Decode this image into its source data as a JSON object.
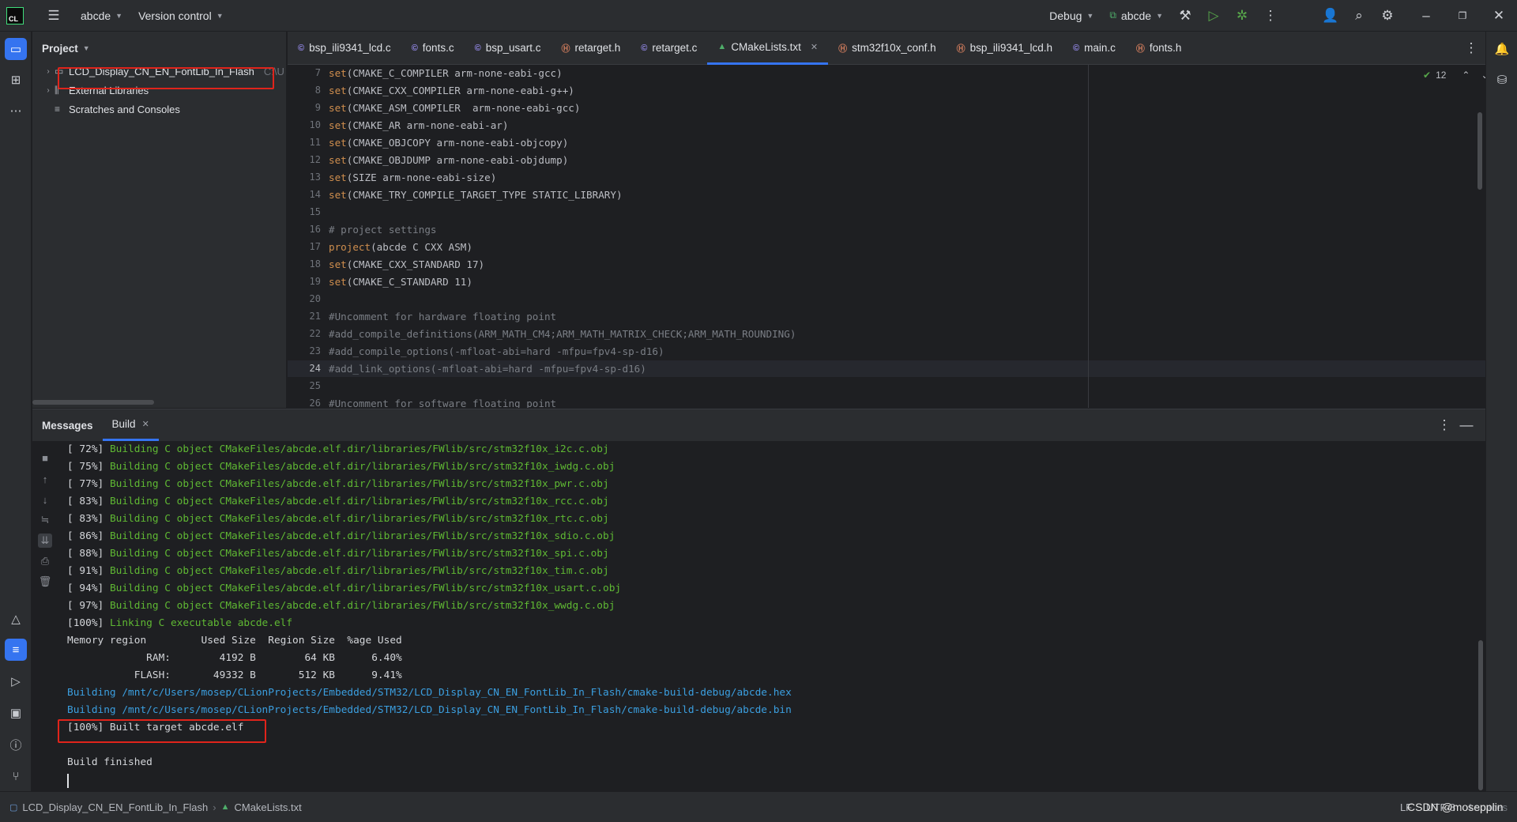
{
  "titlebar": {
    "app_icon": "CL",
    "project_name": "abcde",
    "vcs_label": "Version control",
    "run_config": "Debug",
    "target": "abcde",
    "icons": [
      "hammer-icon",
      "run-icon",
      "debug-icon",
      "more-icon",
      "add-user-icon",
      "search-icon",
      "settings-icon"
    ]
  },
  "window_controls": [
    "minimize",
    "restore",
    "close"
  ],
  "project_panel": {
    "title": "Project",
    "items": [
      {
        "label": "LCD_Display_CN_EN_FontLib_In_Flash",
        "hint": "C:\\U"
      },
      {
        "label": "External Libraries",
        "hint": ""
      },
      {
        "label": "Scratches and Consoles",
        "hint": ""
      }
    ]
  },
  "tabs": [
    {
      "label": "bsp_ili9341_lcd.c",
      "kind": "c"
    },
    {
      "label": "fonts.c",
      "kind": "c"
    },
    {
      "label": "bsp_usart.c",
      "kind": "c"
    },
    {
      "label": "retarget.h",
      "kind": "h"
    },
    {
      "label": "retarget.c",
      "kind": "c"
    },
    {
      "label": "CMakeLists.txt",
      "kind": "cmake",
      "active": true
    },
    {
      "label": "stm32f10x_conf.h",
      "kind": "h"
    },
    {
      "label": "bsp_ili9341_lcd.h",
      "kind": "h"
    },
    {
      "label": "main.c",
      "kind": "c"
    },
    {
      "label": "fonts.h",
      "kind": "h"
    }
  ],
  "editor": {
    "inspection_count": "12",
    "lines": [
      {
        "n": "7",
        "text": "set(CMAKE_C_COMPILER arm-none-eabi-gcc)",
        "kind": "set"
      },
      {
        "n": "8",
        "text": "set(CMAKE_CXX_COMPILER arm-none-eabi-g++)",
        "kind": "set"
      },
      {
        "n": "9",
        "text": "set(CMAKE_ASM_COMPILER  arm-none-eabi-gcc)",
        "kind": "set"
      },
      {
        "n": "10",
        "text": "set(CMAKE_AR arm-none-eabi-ar)",
        "kind": "set"
      },
      {
        "n": "11",
        "text": "set(CMAKE_OBJCOPY arm-none-eabi-objcopy)",
        "kind": "set"
      },
      {
        "n": "12",
        "text": "set(CMAKE_OBJDUMP arm-none-eabi-objdump)",
        "kind": "set"
      },
      {
        "n": "13",
        "text": "set(SIZE arm-none-eabi-size)",
        "kind": "set"
      },
      {
        "n": "14",
        "text": "set(CMAKE_TRY_COMPILE_TARGET_TYPE STATIC_LIBRARY)",
        "kind": "set"
      },
      {
        "n": "15",
        "text": "",
        "kind": "blank"
      },
      {
        "n": "16",
        "text": "# project settings",
        "kind": "comment"
      },
      {
        "n": "17",
        "text": "project(abcde C CXX ASM)",
        "kind": "project"
      },
      {
        "n": "18",
        "text": "set(CMAKE_CXX_STANDARD 17)",
        "kind": "set"
      },
      {
        "n": "19",
        "text": "set(CMAKE_C_STANDARD 11)",
        "kind": "set"
      },
      {
        "n": "20",
        "text": "",
        "kind": "blank"
      },
      {
        "n": "21",
        "text": "#Uncomment for hardware floating point",
        "kind": "comment"
      },
      {
        "n": "22",
        "text": "#add_compile_definitions(ARM_MATH_CM4;ARM_MATH_MATRIX_CHECK;ARM_MATH_ROUNDING)",
        "kind": "comment"
      },
      {
        "n": "23",
        "text": "#add_compile_options(-mfloat-abi=hard -mfpu=fpv4-sp-d16)",
        "kind": "comment"
      },
      {
        "n": "24",
        "text": "#add_link_options(-mfloat-abi=hard -mfpu=fpv4-sp-d16)",
        "kind": "comment",
        "current": true
      },
      {
        "n": "25",
        "text": "",
        "kind": "blank"
      },
      {
        "n": "26",
        "text": "#Uncomment for software floating point",
        "kind": "comment"
      }
    ]
  },
  "bottom_panel": {
    "tabs": [
      "Messages",
      "Build"
    ],
    "console": [
      {
        "text": "[ 72%] ",
        "rest": "Building C object CMakeFiles/abcde.elf.dir/libraries/FWlib/src/stm32f10x_i2c.c.obj",
        "kind": "green"
      },
      {
        "text": "[ 75%] ",
        "rest": "Building C object CMakeFiles/abcde.elf.dir/libraries/FWlib/src/stm32f10x_iwdg.c.obj",
        "kind": "green"
      },
      {
        "text": "[ 77%] ",
        "rest": "Building C object CMakeFiles/abcde.elf.dir/libraries/FWlib/src/stm32f10x_pwr.c.obj",
        "kind": "green"
      },
      {
        "text": "[ 83%] ",
        "rest": "Building C object CMakeFiles/abcde.elf.dir/libraries/FWlib/src/stm32f10x_rcc.c.obj",
        "kind": "green"
      },
      {
        "text": "[ 83%] ",
        "rest": "Building C object CMakeFiles/abcde.elf.dir/libraries/FWlib/src/stm32f10x_rtc.c.obj",
        "kind": "green"
      },
      {
        "text": "[ 86%] ",
        "rest": "Building C object CMakeFiles/abcde.elf.dir/libraries/FWlib/src/stm32f10x_sdio.c.obj",
        "kind": "green"
      },
      {
        "text": "[ 88%] ",
        "rest": "Building C object CMakeFiles/abcde.elf.dir/libraries/FWlib/src/stm32f10x_spi.c.obj",
        "kind": "green"
      },
      {
        "text": "[ 91%] ",
        "rest": "Building C object CMakeFiles/abcde.elf.dir/libraries/FWlib/src/stm32f10x_tim.c.obj",
        "kind": "green"
      },
      {
        "text": "[ 94%] ",
        "rest": "Building C object CMakeFiles/abcde.elf.dir/libraries/FWlib/src/stm32f10x_usart.c.obj",
        "kind": "green"
      },
      {
        "text": "[ 97%] ",
        "rest": "Building C object CMakeFiles/abcde.elf.dir/libraries/FWlib/src/stm32f10x_wwdg.c.obj",
        "kind": "green"
      },
      {
        "text": "[100%] ",
        "rest": "Linking C executable abcde.elf",
        "kind": "green"
      },
      {
        "text": "Memory region         Used Size  Region Size  %age Used",
        "rest": "",
        "kind": "plain"
      },
      {
        "text": "             RAM:        4192 B        64 KB      6.40%",
        "rest": "",
        "kind": "plain"
      },
      {
        "text": "           FLASH:       49332 B       512 KB      9.41%",
        "rest": "",
        "kind": "plain"
      },
      {
        "text": "",
        "rest": "Building /mnt/c/Users/mosep/CLionProjects/Embedded/STM32/LCD_Display_CN_EN_FontLib_In_Flash/cmake-build-debug/abcde.hex",
        "kind": "blue"
      },
      {
        "text": "",
        "rest": "Building /mnt/c/Users/mosep/CLionProjects/Embedded/STM32/LCD_Display_CN_EN_FontLib_In_Flash/cmake-build-debug/abcde.bin",
        "kind": "blue"
      },
      {
        "text": "[100%] Built target abcde.elf",
        "rest": "",
        "kind": "plain"
      },
      {
        "text": "",
        "rest": "",
        "kind": "plain"
      },
      {
        "text": "Build finished",
        "rest": "",
        "kind": "plain"
      }
    ]
  },
  "statusbar": {
    "breadcrumb_project": "LCD_Display_CN_EN_FontLib_In_Flash",
    "breadcrumb_file": "CMakeLists.txt",
    "line_ending": "LF",
    "encoding": "UTF-8",
    "indent": "4 spaces",
    "watermark": "CSDN @mosepplin"
  }
}
